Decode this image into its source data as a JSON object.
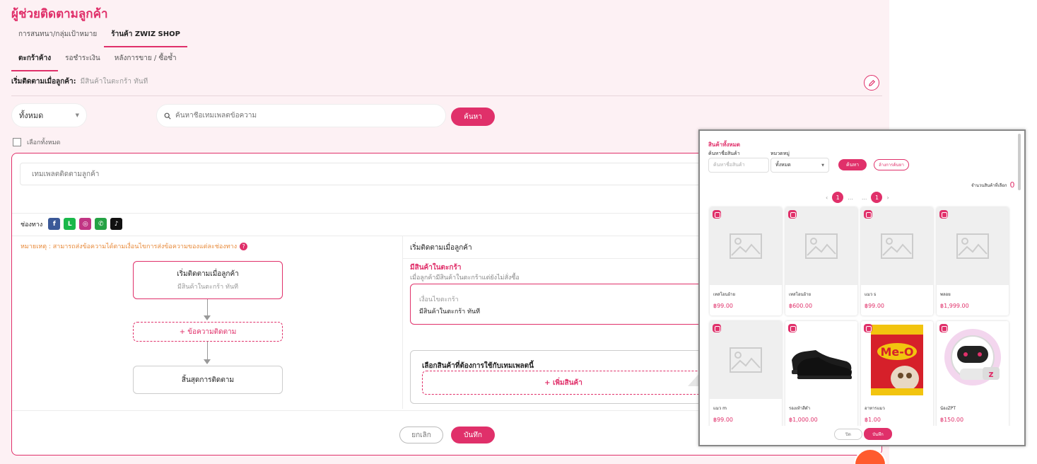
{
  "app": {
    "title": "ผู้ช่วยติดตามลูกค้า"
  },
  "tabs_main": [
    {
      "label": "การสนทนา/กลุ่มเป้าหมาย"
    },
    {
      "label": "ร้านค้า ZWIZ SHOP"
    }
  ],
  "tabs_sub": [
    {
      "label": "ตะกร้าค้าง"
    },
    {
      "label": "รอชำระเงิน"
    },
    {
      "label": "หลังการขาย / ซื้อซ้ำ"
    }
  ],
  "trigger": {
    "label": "เริ่มติดตามเมื่อลูกค้า:",
    "value": "มีสินค้าในตะกร้า ทันที"
  },
  "filter": {
    "dropdown_value": "ทั้งหมด",
    "search_placeholder": "ค้นหาชื่อเทมเพลตข้อความ",
    "search_button": "ค้นหา",
    "select_all": "เลือกทั้งหมด"
  },
  "card": {
    "template_placeholder": "เทมเพลตติดตามลูกค้า",
    "channel_label": "ช่องทาง",
    "note": "หมายเหตุ : สามารถส่งข้อความได้ตามเงื่อนไขการส่งข้อความของแต่ละช่องทาง",
    "flow": {
      "start_title": "เริ่มติดตามเมื่อลูกค้า",
      "start_sub": "มีสินค้าในตะกร้า ทันที",
      "add_message": "+ ข้อความติดตาม",
      "end": "สิ้นสุดการติดตาม"
    },
    "right": {
      "header": "เริ่มติดตามเมื่อลูกค้า",
      "sub_title": "มีสินค้าในตะกร้า",
      "sub_desc": "เมื่อลูกค้ามีสินค้าในตะกร้าแต่ยังไม่สั่งซื้อ",
      "cond_label": "เงื่อนไขตะกร้า",
      "cond_value": "มีสินค้าในตะกร้า ทันที",
      "product_title": "เลือกสินค้าที่ต้องการใช้กับเทมเพลตนี้",
      "add_product": "+ เพิ่มสินค้า"
    },
    "cancel": "ยกเลิก",
    "save": "บันทึก"
  },
  "channels": [
    {
      "name": "facebook",
      "color": "#3b5998",
      "glyph": "f"
    },
    {
      "name": "line",
      "color": "#19b84a",
      "glyph": "L"
    },
    {
      "name": "instagram",
      "color": "#c13584",
      "glyph": "◎"
    },
    {
      "name": "whatsapp",
      "color": "#25a244",
      "glyph": "✆"
    },
    {
      "name": "tiktok",
      "color": "#111111",
      "glyph": "♪"
    }
  ],
  "modal": {
    "title": "สินค้าทั้งหมด",
    "name_label": "ค้นหาชื่อสินค้า",
    "name_placeholder": "ค้นหาชื่อสินค้า",
    "category_label": "หมวดหมู่",
    "category_value": "ทั้งหมด",
    "search_btn": "ค้นหา",
    "clear_btn": "ล้างการค้นหา",
    "count_label": "จำนวนสินค้าที่เลือก",
    "count_value": "0",
    "pager": {
      "first": "1",
      "dots1": "...",
      "dots2": "...",
      "last": "1"
    },
    "close_btn": "ปิด",
    "save_btn": "บันทึก",
    "products": [
      {
        "name": "เทสโอนย้าย",
        "price": "฿99.00",
        "image": "placeholder"
      },
      {
        "name": "เทสโอนย้าย",
        "price": "฿600.00",
        "image": "placeholder"
      },
      {
        "name": "แมว s",
        "price": "฿99.00",
        "image": "placeholder"
      },
      {
        "name": "พลอย",
        "price": "฿1,999.00",
        "image": "placeholder"
      },
      {
        "name": "แมว m",
        "price": "฿99.00",
        "image": "placeholder"
      },
      {
        "name": "รองเท้าสีดำ",
        "price": "฿1,000.00",
        "image": "black-shoe"
      },
      {
        "name": "อาหารแมว",
        "price": "฿1.00",
        "image": "cat-food"
      },
      {
        "name": "น้องZPT",
        "price": "฿150.00",
        "image": "robot"
      }
    ]
  }
}
